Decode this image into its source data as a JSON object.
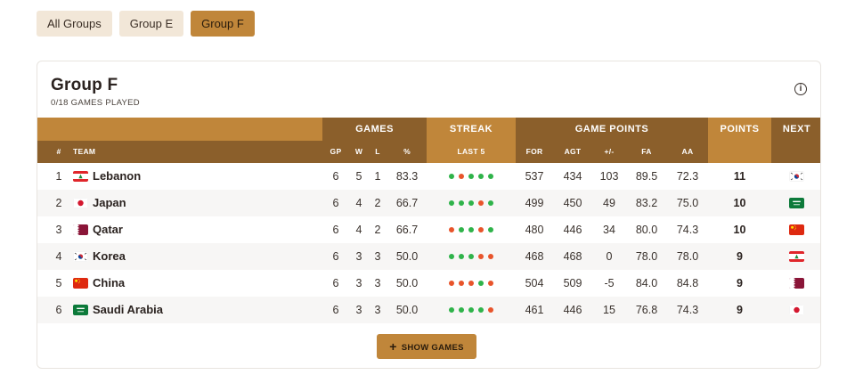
{
  "tabs": [
    "All Groups",
    "Group E",
    "Group F"
  ],
  "active_tab": "Group F",
  "card": {
    "title": "Group F",
    "subtitle": "0/18 GAMES PLAYED",
    "info_glyph": "i"
  },
  "header_groups": {
    "games": "GAMES",
    "streak": "STREAK",
    "game_points": "GAME POINTS",
    "points": "POINTS",
    "next": "NEXT"
  },
  "columns": {
    "rank": "#",
    "team": "TEAM",
    "gp": "GP",
    "w": "W",
    "l": "L",
    "pct": "%",
    "last5": "LAST 5",
    "for": "FOR",
    "agt": "AGT",
    "diff": "+/-",
    "fa": "FA",
    "aa": "AA"
  },
  "rows": [
    {
      "rank": "1",
      "team": "Lebanon",
      "flag": "lebanon-flag-icon",
      "gp": "6",
      "w": "5",
      "l": "1",
      "pct": "83.3",
      "streak": [
        "W",
        "L",
        "W",
        "W",
        "W"
      ],
      "for": "537",
      "agt": "434",
      "diff": "103",
      "fa": "89.5",
      "aa": "72.3",
      "points": "11",
      "next": "korea-flag-icon"
    },
    {
      "rank": "2",
      "team": "Japan",
      "flag": "japan-flag-icon",
      "gp": "6",
      "w": "4",
      "l": "2",
      "pct": "66.7",
      "streak": [
        "W",
        "W",
        "W",
        "L",
        "W"
      ],
      "for": "499",
      "agt": "450",
      "diff": "49",
      "fa": "83.2",
      "aa": "75.0",
      "points": "10",
      "next": "saudi-arabia-flag-icon"
    },
    {
      "rank": "3",
      "team": "Qatar",
      "flag": "qatar-flag-icon",
      "gp": "6",
      "w": "4",
      "l": "2",
      "pct": "66.7",
      "streak": [
        "L",
        "W",
        "W",
        "L",
        "W"
      ],
      "for": "480",
      "agt": "446",
      "diff": "34",
      "fa": "80.0",
      "aa": "74.3",
      "points": "10",
      "next": "china-flag-icon"
    },
    {
      "rank": "4",
      "team": "Korea",
      "flag": "korea-flag-icon",
      "gp": "6",
      "w": "3",
      "l": "3",
      "pct": "50.0",
      "streak": [
        "W",
        "W",
        "W",
        "L",
        "L"
      ],
      "for": "468",
      "agt": "468",
      "diff": "0",
      "fa": "78.0",
      "aa": "78.0",
      "points": "9",
      "next": "lebanon-flag-icon"
    },
    {
      "rank": "5",
      "team": "China",
      "flag": "china-flag-icon",
      "gp": "6",
      "w": "3",
      "l": "3",
      "pct": "50.0",
      "streak": [
        "L",
        "L",
        "L",
        "W",
        "L"
      ],
      "for": "504",
      "agt": "509",
      "diff": "-5",
      "fa": "84.0",
      "aa": "84.8",
      "points": "9",
      "next": "qatar-flag-icon"
    },
    {
      "rank": "6",
      "team": "Saudi Arabia",
      "flag": "saudi-arabia-flag-icon",
      "gp": "6",
      "w": "3",
      "l": "3",
      "pct": "50.0",
      "streak": [
        "W",
        "W",
        "W",
        "W",
        "L"
      ],
      "for": "461",
      "agt": "446",
      "diff": "15",
      "fa": "76.8",
      "aa": "74.3",
      "points": "9",
      "next": "japan-flag-icon"
    }
  ],
  "show_games_button": "SHOW GAMES",
  "colors": {
    "accent": "#c0863a",
    "accent_dark": "#8b5f2b",
    "win": "#2fb34a",
    "loss": "#e8542b"
  }
}
